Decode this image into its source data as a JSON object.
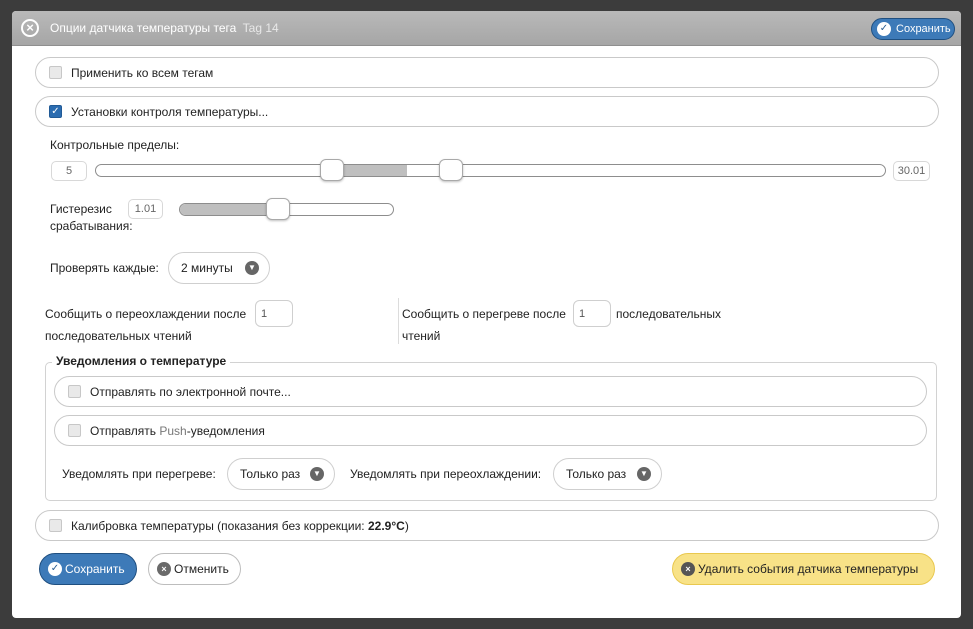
{
  "dialog": {
    "title": "Опции датчика температуры тега",
    "tag_name": "Tag 14",
    "save_top_label": "Сохранить"
  },
  "apply_all": {
    "label": "Применить ко всем тегам",
    "checked": false
  },
  "monitor": {
    "label": "Установки контроля температуры...",
    "checked": true
  },
  "limits": {
    "label": "Контрольные пределы:",
    "min_value": "5",
    "max_value": "30.01",
    "low_fraction": 0.3,
    "high_fraction": 0.45
  },
  "hysteresis": {
    "label_line1": "Гистерезис",
    "label_line2": "срабатывания:",
    "value": "1.01",
    "fraction": 0.46
  },
  "check_interval": {
    "label": "Проверять каждые:",
    "value": "2 минуты"
  },
  "overcool": {
    "label_part1": "Сообщить о переохлаждении после",
    "label_part2": "последовательных чтений",
    "value": "1"
  },
  "overheat": {
    "label_part1": "Сообщить о перегреве после",
    "label_part2": "последовательных",
    "label_part3": "чтений",
    "value": "1"
  },
  "notifications": {
    "legend": "Уведомления о температуре",
    "email": {
      "label": "Отправлять по электронной почте...",
      "checked": false
    },
    "push": {
      "label_prefix": "Отправлять",
      "label_push": "Push",
      "label_suffix": "-уведомления",
      "checked": false
    },
    "notify_overheat": {
      "label": "Уведомлять при перегреве:",
      "value": "Только раз"
    },
    "notify_overcool": {
      "label": "Уведомлять при переохлаждении:",
      "value": "Только раз"
    }
  },
  "calibration": {
    "label": "Калибровка температуры (показания без коррекции:",
    "reading": "22.9°C",
    "label_end": ")",
    "checked": false
  },
  "actions": {
    "save": "Сохранить",
    "cancel": "Отменить",
    "delete": "Удалить события датчика температуры"
  },
  "colors": {
    "primary": "#3d7ab8",
    "warning": "#f8e287",
    "titlebar": "#a6a6a6"
  }
}
